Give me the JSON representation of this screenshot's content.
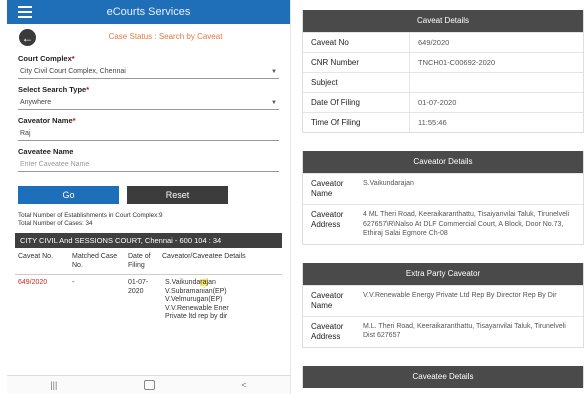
{
  "app": {
    "title": "eCourts Services"
  },
  "page": {
    "heading": "Case Status : Search by Caveat"
  },
  "form": {
    "court_complex_label": "Court Complex",
    "court_complex_value": "City Civil Court Complex, Chennai",
    "search_type_label": "Select Search Type",
    "search_type_value": "Anywhere",
    "caveator_label": "Caveator Name",
    "caveator_value": "Raj",
    "caveatee_label": "Caveatee Name",
    "caveatee_placeholder": "Enter Caveatee Name",
    "required_mark": "*",
    "go_label": "Go",
    "reset_label": "Reset"
  },
  "totals": {
    "establishments": "Total Number of Establishments in Court Complex:9",
    "cases": "Total Number of Cases: 34"
  },
  "court": {
    "name": "CITY CIVIL And SESSIONS COURT, Chennai - 600 104 : 34"
  },
  "results_table": {
    "headers": [
      "Caveat No.",
      "Matched Case No.",
      "Date of Filing",
      "Caveator/Caveatee Details"
    ],
    "rows": [
      {
        "caveat_no": "649/2020",
        "matched_case": "-",
        "date_filing": "01-07-2020",
        "details_prefix": "S.Vaikunda",
        "details_highlight": "raj",
        "details_suffix": "an",
        "details_more": [
          "V.Subramanian(EP)",
          "V.Velmurugan(EP)",
          "V.V.Renewable Ener",
          "Private ltd rep by dir"
        ]
      }
    ]
  },
  "nav": {
    "back": "<",
    "home": "",
    "recent": "|||"
  },
  "icons": {
    "menu": "menu-icon",
    "back": "back-arrow-icon"
  },
  "caveat_details": {
    "title": "Caveat Details",
    "rows": [
      {
        "label": "Caveat No",
        "value": "649/2020"
      },
      {
        "label": "CNR Number",
        "value": "TNCH01-C00692-2020"
      },
      {
        "label": "Subject",
        "value": ""
      },
      {
        "label": "Date Of Filing",
        "value": "01-07-2020"
      },
      {
        "label": "Time Of Filing",
        "value": "11:55:46"
      }
    ]
  },
  "caveator_details": {
    "title": "Caveator Details",
    "name_label": "Caveator Name",
    "name_value": "S.Vaikundarajan",
    "address_label": "Caveator Address",
    "address_value": "4 ML Theri Road, Keeraikaranthattu, Tisaiyanvilai Taluk, Tirunelveli 627657\\R\\Nalso At DLF Commercial Court, A Block, Door No.73, Ethiraj Salai Egmore Ch-08"
  },
  "extra_party": {
    "title": "Extra Party Caveator",
    "name_label": "Caveator Name",
    "name_value": "V.V.Renewable Energy Private Ltd Rep By Director Rep By Dir",
    "address_label": "Caveator Address",
    "address_value": "M.L. Theri Road, Keeraikaranthattu, Tisayanvilai Taluk, Tirunelveli Dist 627657"
  },
  "caveatee_details": {
    "title": "Caveatee Details"
  },
  "colors": {
    "app_bar": "#1f6fb8",
    "section_header": "#4a4a4a",
    "caveat_no_link": "#c62828",
    "heading": "#e27a3f"
  }
}
